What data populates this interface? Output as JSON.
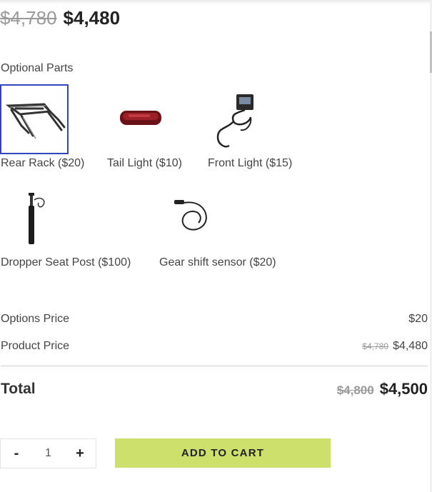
{
  "price": {
    "old": "$4,780",
    "current": "$4,480"
  },
  "optional_parts": {
    "heading": "Optional Parts",
    "items": [
      {
        "label": "Rear Rack ($20)",
        "icon": "rear-rack-icon",
        "selected": true
      },
      {
        "label": "Tail Light ($10)",
        "icon": "tail-light-icon",
        "selected": false
      },
      {
        "label": "Front Light ($15)",
        "icon": "front-light-icon",
        "selected": false
      },
      {
        "label": "Dropper Seat Post ($100)",
        "icon": "dropper-seat-post-icon",
        "selected": false
      },
      {
        "label": "Gear shift sensor ($20)",
        "icon": "gear-shift-sensor-icon",
        "selected": false
      }
    ]
  },
  "summary": {
    "options_label": "Options Price",
    "options_value": "$20",
    "product_label": "Product Price",
    "product_old": "$4,780",
    "product_current": "$4,480",
    "total_label": "Total",
    "total_old": "$4,800",
    "total_current": "$4,500"
  },
  "cart": {
    "minus": "-",
    "quantity": "1",
    "plus": "+",
    "button": "ADD TO CART"
  },
  "colors": {
    "accent": "#cde06c",
    "selected_border": "#3344bb"
  }
}
